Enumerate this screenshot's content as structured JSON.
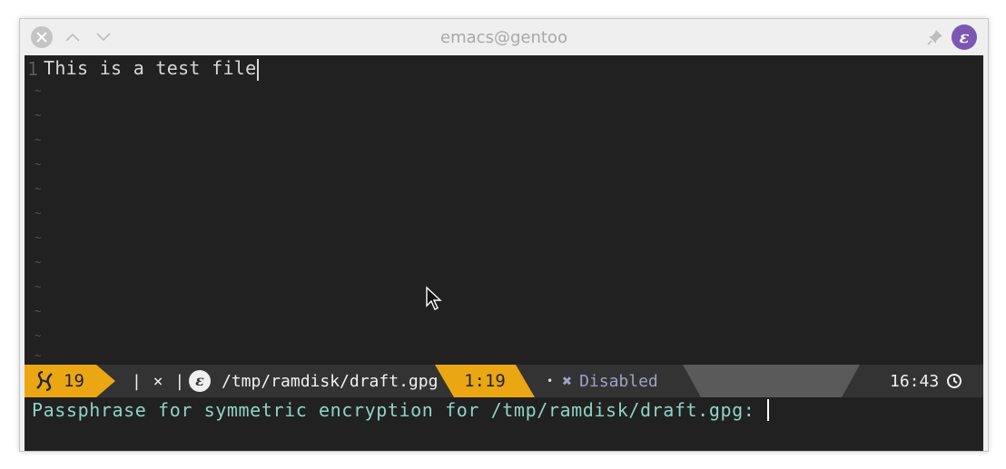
{
  "window": {
    "title": "emacs@gentoo"
  },
  "icons": {
    "close": "close-icon",
    "minimize": "chevron-up-icon",
    "maximize": "chevron-down-icon",
    "pin": "pin-icon",
    "app": "emacs-icon",
    "window_number": "window-icon",
    "buffer": "emacs-buffer-icon",
    "flycheck": "x-mark-icon",
    "clock": "clock-icon"
  },
  "colors": {
    "accent": "#eaa713",
    "background": "#212121",
    "minibuffer_text": "#8fd3c6"
  },
  "buffer": {
    "line_number": "1",
    "line_text": "This is a test file",
    "tilde": "~"
  },
  "modeline": {
    "window_number": "19",
    "state": "| × |",
    "file_path": "/tmp/ramdisk/draft.gpg",
    "position": "1:19",
    "dot": "•",
    "flycheck_mark": "✖",
    "flycheck_status": "Disabled",
    "time": "16:43"
  },
  "minibuffer": {
    "prompt": "Passphrase for symmetric encryption for /tmp/ramdisk/draft.gpg:"
  }
}
